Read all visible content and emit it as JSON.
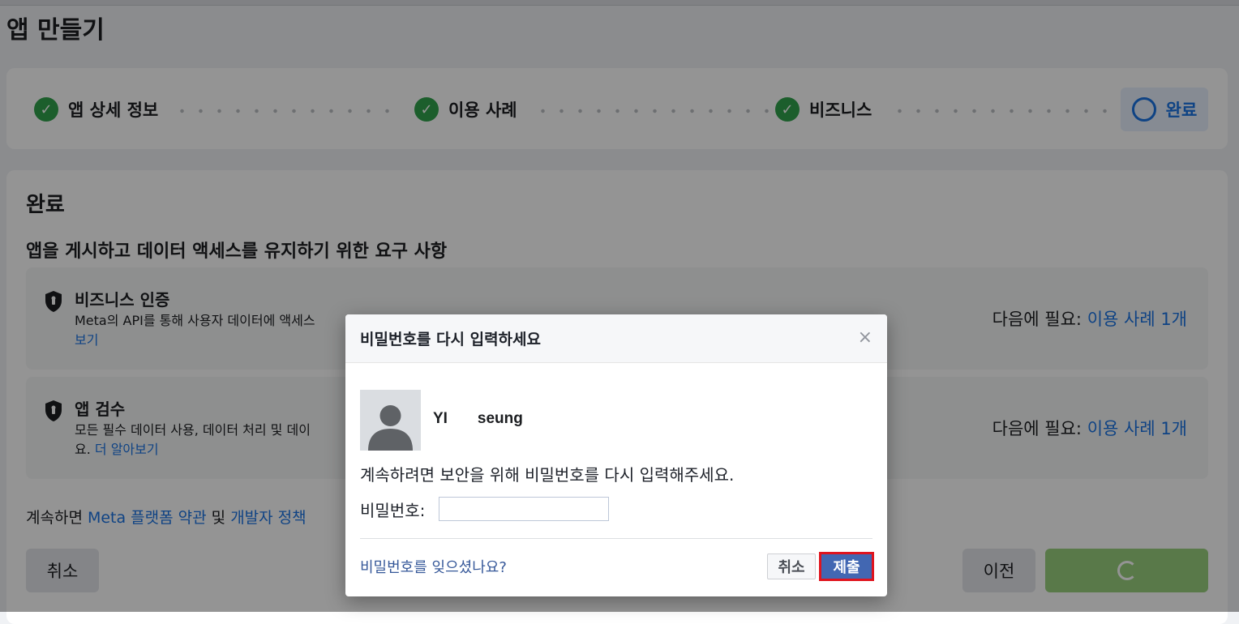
{
  "page": {
    "title": "앱 만들기"
  },
  "stepper": {
    "steps": [
      {
        "label": "앱 상세 정보",
        "status": "done"
      },
      {
        "label": "이용 사례",
        "status": "done"
      },
      {
        "label": "비즈니스",
        "status": "done"
      },
      {
        "label": "완료",
        "status": "current"
      }
    ]
  },
  "main": {
    "title": "완료",
    "subtitle": "앱을 게시하고 데이터 액세스를 유지하기 위한 요구 사항",
    "requirements": [
      {
        "title": "비즈니스 인증",
        "desc": "Meta의 API를 통해 사용자 데이터에 액세스",
        "link": "보기",
        "needed_label": "다음에 필요:",
        "needed_link": "이용 사례 1개"
      },
      {
        "title": "앱 검수",
        "desc_line1": "모든 필수 데이터 사용, 데이터 처리 및 데이",
        "desc_line2": "요.",
        "link": "더 알아보기",
        "needed_label": "다음에 필요:",
        "needed_link": "이용 사례 1개"
      }
    ],
    "terms": {
      "prefix": "계속하면",
      "platform_terms": "Meta 플랫폼 약관",
      "and": "및",
      "dev_policy": "개발자 정책"
    },
    "buttons": {
      "cancel": "취소",
      "prev": "이전"
    }
  },
  "modal": {
    "title": "비밀번호를 다시 입력하세요",
    "close": "×",
    "user_name": "YI       seung",
    "message": "계속하려면 보안을 위해 비밀번호를 다시 입력해주세요.",
    "password_label": "비밀번호:",
    "password_value": "",
    "forgot_link": "비밀번호를 잊으셨나요?",
    "cancel": "취소",
    "submit": "제출"
  },
  "colors": {
    "accent": "#1b74e4",
    "success": "#31a24c",
    "submit": "#4267b2",
    "highlight": "#e0141e"
  }
}
